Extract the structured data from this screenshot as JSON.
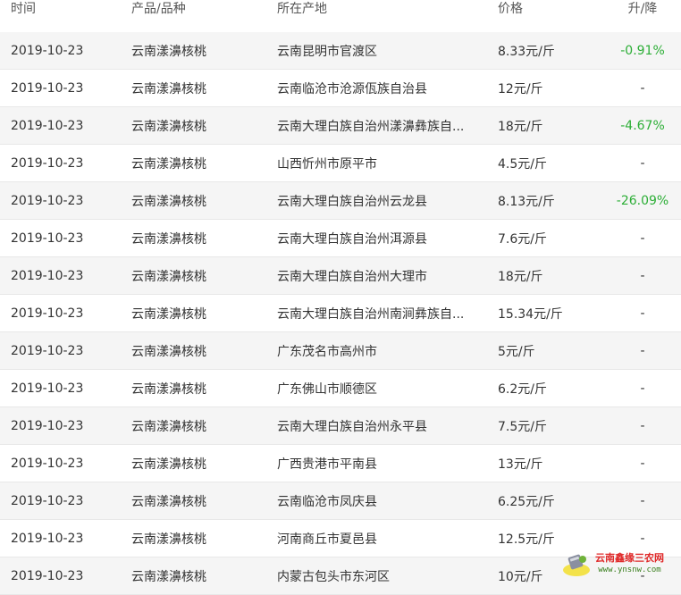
{
  "header": {
    "time": "时间",
    "product": "产品/品种",
    "location": "所在产地",
    "price": "价格",
    "change": "升/降"
  },
  "rows": [
    {
      "date": "2019-10-23",
      "product": "云南漾濞核桃",
      "location": "云南昆明市官渡区",
      "price": "8.33元/斤",
      "change": "-0.91%",
      "trend": "down"
    },
    {
      "date": "2019-10-23",
      "product": "云南漾濞核桃",
      "location": "云南临沧市沧源佤族自治县",
      "price": "12元/斤",
      "change": "-",
      "trend": "flat"
    },
    {
      "date": "2019-10-23",
      "product": "云南漾濞核桃",
      "location": "云南大理白族自治州漾濞彝族自...",
      "price": "18元/斤",
      "change": "-4.67%",
      "trend": "down"
    },
    {
      "date": "2019-10-23",
      "product": "云南漾濞核桃",
      "location": "山西忻州市原平市",
      "price": "4.5元/斤",
      "change": "-",
      "trend": "flat"
    },
    {
      "date": "2019-10-23",
      "product": "云南漾濞核桃",
      "location": "云南大理白族自治州云龙县",
      "price": "8.13元/斤",
      "change": "-26.09%",
      "trend": "down"
    },
    {
      "date": "2019-10-23",
      "product": "云南漾濞核桃",
      "location": "云南大理白族自治州洱源县",
      "price": "7.6元/斤",
      "change": "-",
      "trend": "flat"
    },
    {
      "date": "2019-10-23",
      "product": "云南漾濞核桃",
      "location": "云南大理白族自治州大理市",
      "price": "18元/斤",
      "change": "-",
      "trend": "flat"
    },
    {
      "date": "2019-10-23",
      "product": "云南漾濞核桃",
      "location": "云南大理白族自治州南涧彝族自...",
      "price": "15.34元/斤",
      "change": "-",
      "trend": "flat"
    },
    {
      "date": "2019-10-23",
      "product": "云南漾濞核桃",
      "location": "广东茂名市高州市",
      "price": "5元/斤",
      "change": "-",
      "trend": "flat"
    },
    {
      "date": "2019-10-23",
      "product": "云南漾濞核桃",
      "location": "广东佛山市顺德区",
      "price": "6.2元/斤",
      "change": "-",
      "trend": "flat"
    },
    {
      "date": "2019-10-23",
      "product": "云南漾濞核桃",
      "location": "云南大理白族自治州永平县",
      "price": "7.5元/斤",
      "change": "-",
      "trend": "flat"
    },
    {
      "date": "2019-10-23",
      "product": "云南漾濞核桃",
      "location": "广西贵港市平南县",
      "price": "13元/斤",
      "change": "-",
      "trend": "flat"
    },
    {
      "date": "2019-10-23",
      "product": "云南漾濞核桃",
      "location": "云南临沧市凤庆县",
      "price": "6.25元/斤",
      "change": "-",
      "trend": "flat"
    },
    {
      "date": "2019-10-23",
      "product": "云南漾濞核桃",
      "location": "河南商丘市夏邑县",
      "price": "12.5元/斤",
      "change": "-",
      "trend": "flat"
    },
    {
      "date": "2019-10-23",
      "product": "云南漾濞核桃",
      "location": "内蒙古包头市东河区",
      "price": "10元/斤",
      "change": "-",
      "trend": "flat"
    }
  ],
  "watermark": {
    "title": "云南鑫缘三农网",
    "url": "www.ynsnw.com"
  },
  "colors": {
    "down": "#2cae36",
    "alt_row": "#f5f5f5",
    "watermark_title": "#e02a2a",
    "watermark_url": "#3a7f1e"
  }
}
